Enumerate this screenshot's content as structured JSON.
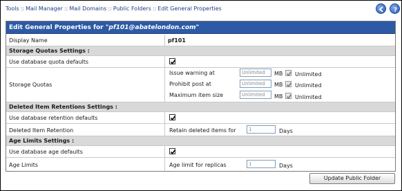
{
  "breadcrumb": {
    "items": [
      "Tools",
      "Mail Manager",
      "Mail Domains",
      "Public Folders",
      "Edit General Properties"
    ],
    "separator": "::"
  },
  "nav": {
    "back_icon": "back-arrow-icon",
    "help_icon": "help-icon"
  },
  "panel": {
    "title_prefix": "Edit General Properties for ",
    "title_folder": "\"pf101@abatelondon.com\""
  },
  "display_name": {
    "label": "Display Name",
    "value": "pf101"
  },
  "storage": {
    "section": "Storage Quotas Settings :",
    "use_defaults_label": "Use database quota defaults",
    "use_defaults_checked": true,
    "quotas_label": "Storage Quotas",
    "issue_warning": {
      "label": "Issue warning at",
      "placeholder": "Unlimited",
      "unit": "MB",
      "unlimited_label": "Unlimited"
    },
    "prohibit_post": {
      "label": "Prohibit post at",
      "placeholder": "Unlimited",
      "unit": "MB",
      "unlimited_label": "Unlimited"
    },
    "max_item": {
      "label": "Maximum item size",
      "placeholder": "Unlimited",
      "unit": "MB",
      "unlimited_label": "Unlimited"
    }
  },
  "retention": {
    "section": "Deleted Item Retentions Settings :",
    "use_defaults_label": "Use database retention defaults",
    "use_defaults_checked": true,
    "label": "Deleted Item Retention",
    "sub_label": "Retain deleted items for",
    "placeholder": "1",
    "unit": "Days"
  },
  "age": {
    "section": "Age Limits Settings :",
    "use_defaults_label": "Use database age defaults",
    "use_defaults_checked": true,
    "label": "Age Limits",
    "sub_label": "Age limit for replicas",
    "placeholder": "1",
    "unit": "Days"
  },
  "actions": {
    "update_label": "Update Public Folder"
  },
  "colors": {
    "title_bar": "#2d5aa4",
    "section_bg": "#d9d9d9",
    "link": "#1f3d8a"
  }
}
